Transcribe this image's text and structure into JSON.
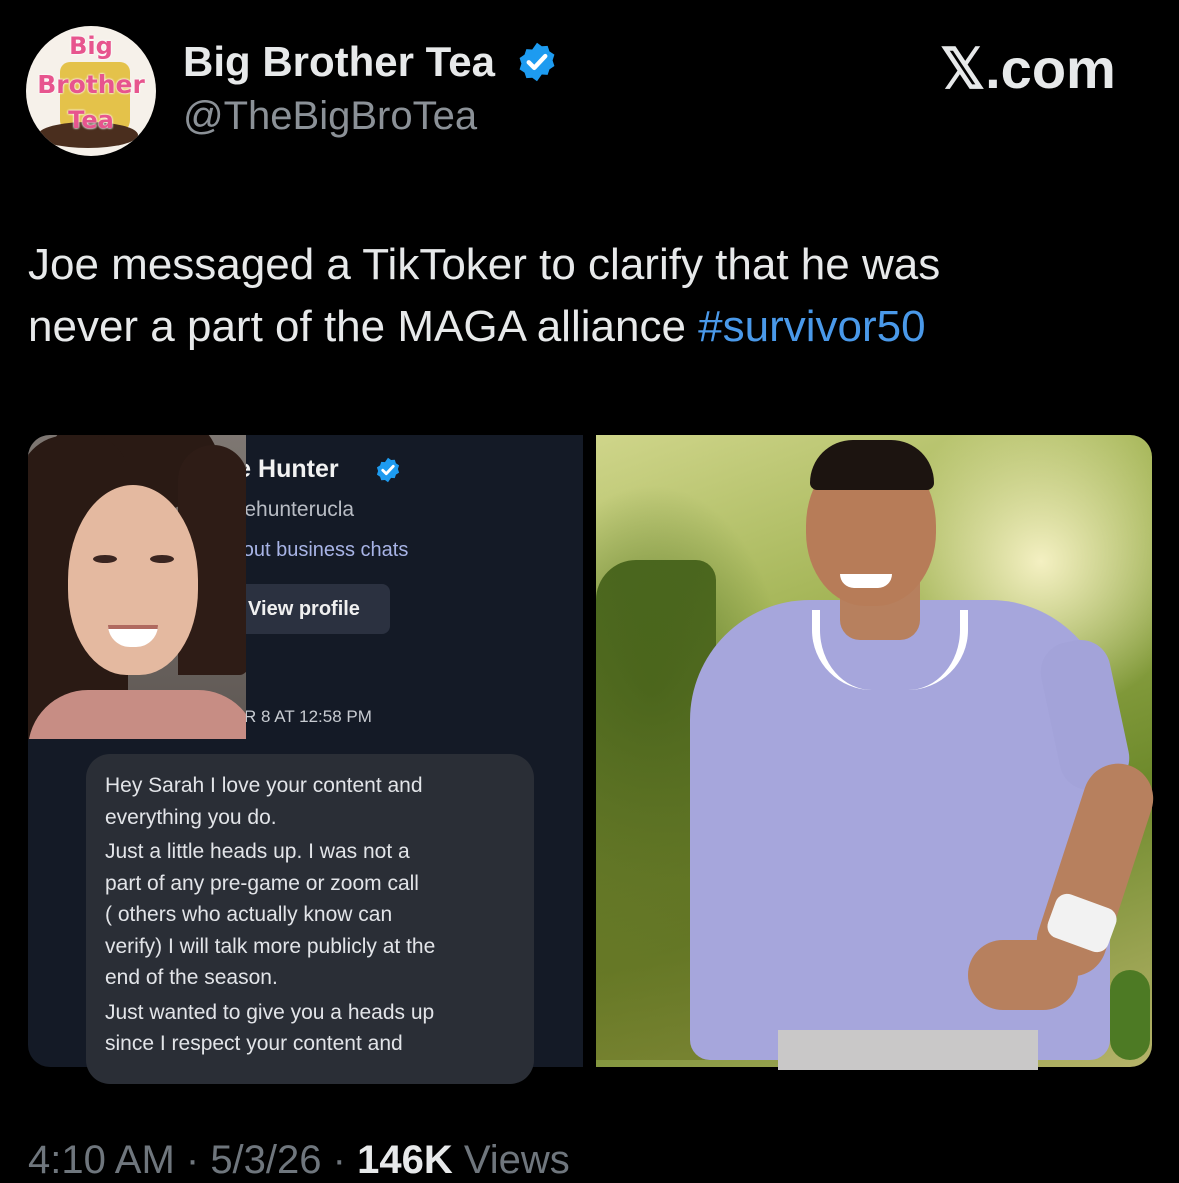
{
  "account": {
    "avatar_text": [
      "Big",
      "Brother",
      "Tea"
    ],
    "display_name": "Big Brother Tea",
    "handle": "@TheBigBroTea",
    "verified_icon": "verified-badge-icon"
  },
  "brand": {
    "logo_text": "𝕏.com"
  },
  "tweet": {
    "text_line1": "Joe messaged a TikToker to clarify that he was",
    "text_line2": "never a part of the MAGA alliance ",
    "hashtag": "#survivor50"
  },
  "media": {
    "screenshot": {
      "contact_name": "Joe Hunter",
      "contact_username": "joehunterucla",
      "learn_link": "arn about business chats",
      "view_profile_label": "View profile",
      "timestamp": "R 8 AT 12:58 PM",
      "message_lines": [
        "Hey Sarah I love your content and",
        "everything you do.",
        "Just a little heads up. I was not a",
        "part of any pre-game or zoom call",
        "( others who actually know can",
        "verify) I will talk more publicly at the",
        "end of the season.",
        "Just wanted to give you a heads up",
        "since I respect your content and"
      ]
    },
    "photo": {
      "subject": "man-in-lavender-polo-photo"
    }
  },
  "meta": {
    "time": "4:10 AM",
    "sep1": " · ",
    "date": "5/3/26",
    "sep2": " · ",
    "views_count": "146K",
    "views_label": " Views"
  },
  "colors": {
    "background": "#000000",
    "text": "#e7e9ea",
    "muted": "#6f767d",
    "link": "#4a99e9",
    "verified": "#1d9bf0"
  }
}
